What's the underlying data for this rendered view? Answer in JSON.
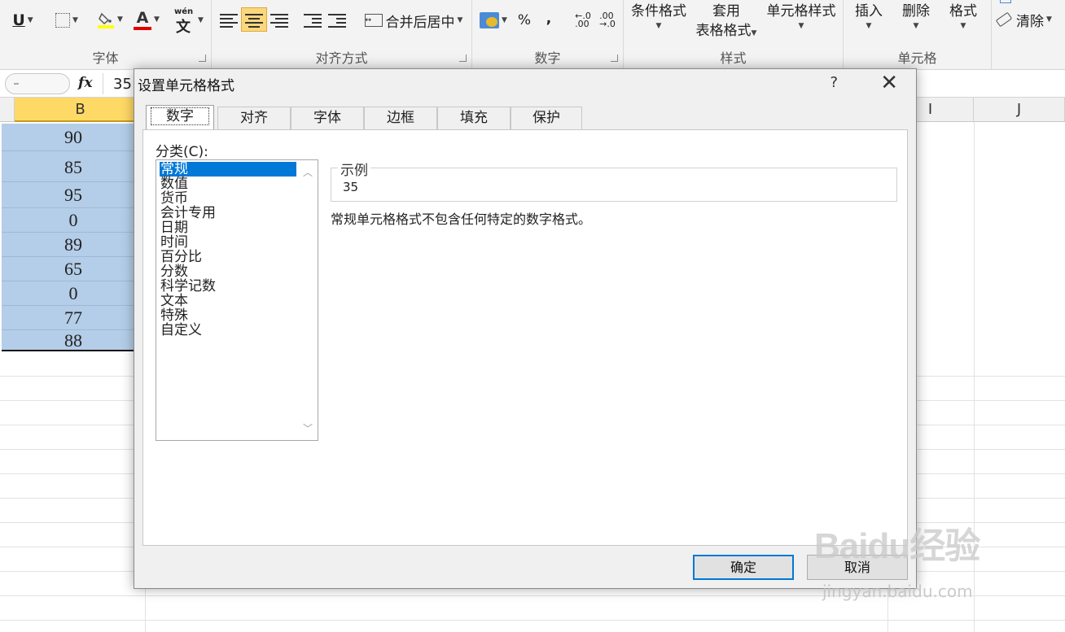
{
  "ribbon": {
    "font_group": {
      "label": "字体",
      "underline_btn": "U",
      "font_color_btn": "A",
      "phonetic_btn": "wén"
    },
    "align_group": {
      "label": "对齐方式",
      "merge_center": "合并后居中"
    },
    "number_group": {
      "label": "数字",
      "percent": "%",
      "comma": ","
    },
    "styles_group": {
      "label": "样式",
      "conditional_format": "条件格式",
      "format_as_table_line1": "套用",
      "format_as_table_line2": "表格格式",
      "cell_styles": "单元格样式"
    },
    "cells_group": {
      "label": "单元格",
      "insert": "插入",
      "delete": "删除",
      "format": "格式"
    },
    "edit_group": {
      "clear": "清除"
    }
  },
  "formula_bar": {
    "fx": "fx",
    "value": "35"
  },
  "sheet": {
    "columns": [
      {
        "letter": "B",
        "selected": true
      },
      {
        "letter": "I",
        "selected": false
      },
      {
        "letter": "J",
        "selected": false
      }
    ],
    "column_b_values": [
      "90",
      "85",
      "95",
      "0",
      "89",
      "65",
      "0",
      "77",
      "88"
    ]
  },
  "dialog": {
    "title": "设置单元格格式",
    "help": "?",
    "close": "✕",
    "tabs": [
      "数字",
      "对齐",
      "字体",
      "边框",
      "填充",
      "保护"
    ],
    "active_tab": "数字",
    "category_label": "分类(C):",
    "categories": [
      "常规",
      "数值",
      "货币",
      "会计专用",
      "日期",
      "时间",
      "百分比",
      "分数",
      "科学记数",
      "文本",
      "特殊",
      "自定义"
    ],
    "selected_category": "常规",
    "sample_label": "示例",
    "sample_value": "35",
    "description": "常规单元格格式不包含任何特定的数字格式。",
    "ok_button": "确定",
    "cancel_button": "取消"
  },
  "watermark": {
    "logo": "Baidu经验",
    "url": "jingyan.baidu.com"
  },
  "colors": {
    "selection_fill": "#b4cde8",
    "selected_header": "#ffd966",
    "accent": "#0078d7"
  }
}
